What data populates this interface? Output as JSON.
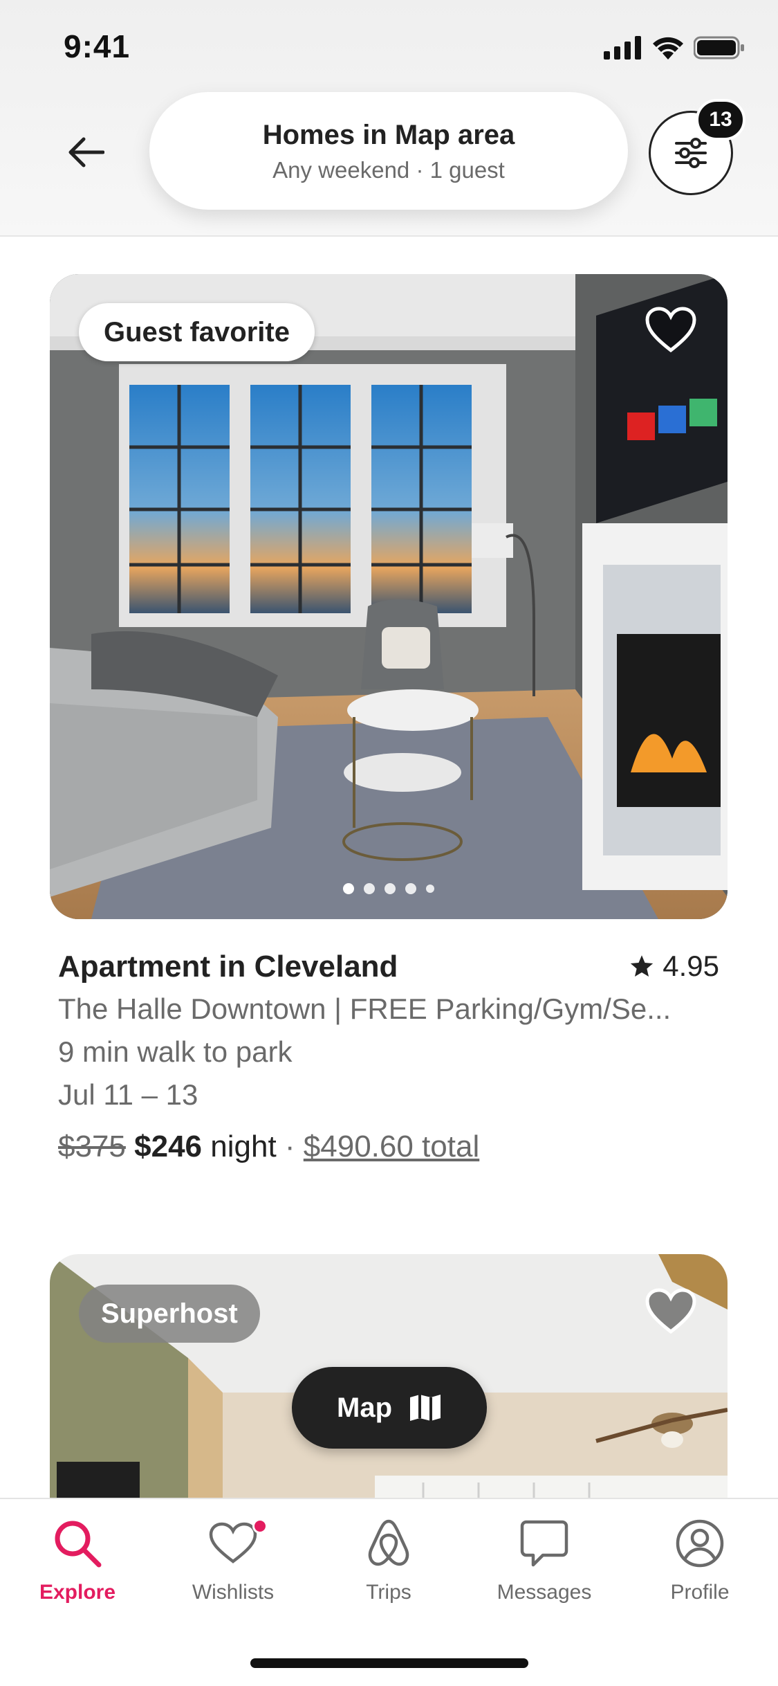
{
  "status_bar": {
    "time": "9:41"
  },
  "header": {
    "title": "Homes in Map area",
    "subtitle": "Any weekend · 1 guest",
    "filter_count": "13"
  },
  "listing": {
    "badge": "Guest favorite",
    "title": "Apartment in Cleveland",
    "rating": "4.95",
    "name": "The Halle Downtown | FREE Parking/Gym/Se...",
    "distance": "9 min walk to park",
    "dates": "Jul 11 – 13",
    "price_original": "$375",
    "price_current": "$246",
    "price_unit": "night",
    "separator": " · ",
    "price_total": "$490.60 total",
    "photo_count": 5,
    "active_photo": 1
  },
  "listing2": {
    "badge": "Superhost"
  },
  "map_button": {
    "label": "Map"
  },
  "tabs": [
    {
      "label": "Explore",
      "icon": "search-icon",
      "active": true
    },
    {
      "label": "Wishlists",
      "icon": "heart-icon",
      "active": false,
      "notification": true
    },
    {
      "label": "Trips",
      "icon": "airbnb-logo-icon",
      "active": false
    },
    {
      "label": "Messages",
      "icon": "message-icon",
      "active": false
    },
    {
      "label": "Profile",
      "icon": "profile-icon",
      "active": false
    }
  ],
  "colors": {
    "accent": "#e31c5f",
    "text": "#222222",
    "muted": "#6a6a6a"
  }
}
